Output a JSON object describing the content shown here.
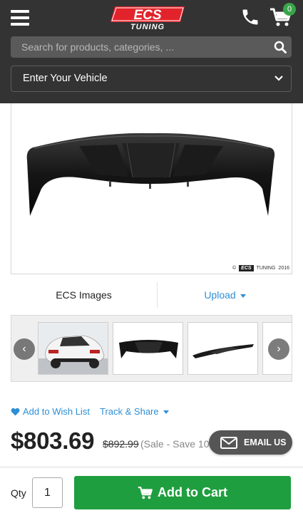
{
  "header": {
    "logo_top": "ECS",
    "logo_bottom": "TUNING",
    "cart_count": "0",
    "search_placeholder": "Search for products, categories, ...",
    "vehicle_label": "Enter Your Vehicle",
    "icons": [
      "menu-icon",
      "phone-icon",
      "cart-icon",
      "search-icon",
      "chevron-down-icon"
    ]
  },
  "product_image": {
    "watermark_prefix": "©",
    "watermark_brand": "ECS",
    "watermark_tuning": "TUNING",
    "watermark_year": "2016"
  },
  "image_tabs": {
    "ecs_images": "ECS Images",
    "upload": "Upload"
  },
  "carousel": {
    "prev": "‹",
    "next": "›"
  },
  "actions": {
    "wishlist": "Add to Wish List",
    "track_share": "Track & Share"
  },
  "pricing": {
    "price": "$803.69",
    "old_price": "$892.99",
    "sale_info": "(Sale - Save 10%)"
  },
  "email_us": "EMAIL US",
  "cart": {
    "qty_label": "Qty",
    "qty_value": "1",
    "add_to_cart": "Add to Cart"
  },
  "colors": {
    "header_bg": "#333333",
    "accent_red": "#e3232b",
    "link_blue": "#2d8fd5",
    "cart_green": "#1f9e3f",
    "badge_green": "#38a54a"
  }
}
